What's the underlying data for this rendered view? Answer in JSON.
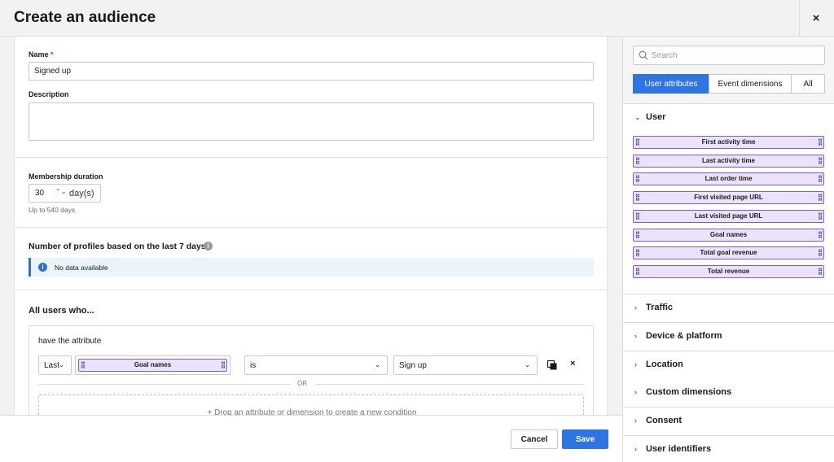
{
  "header": {
    "title": "Create an audience",
    "close_icon": "×"
  },
  "form": {
    "name_label": "Name",
    "required_mark": "*",
    "name_value": "Signed up",
    "description_label": "Description",
    "description_value": "",
    "membership_label": "Membership duration",
    "duration_value": "30",
    "stepper_icon": "⌃⌄",
    "duration_unit": "day(s)",
    "duration_hint": "Up to 540 days",
    "profiles_title": "Number of profiles based on the last 7 days",
    "info_icon_text": "i",
    "no_data_text": "No data available",
    "all_users_title": "All users who...",
    "condition": {
      "title": "have the attribute",
      "qualifier": "Last",
      "attribute": "Goal names",
      "operator": "is",
      "value": "Sign up",
      "chevron": "⌄",
      "delete_icon": "×",
      "or_label": "OR",
      "drop_hint": "+ Drop an attribute or dimension to create a new condition"
    }
  },
  "footer": {
    "cancel_label": "Cancel",
    "save_label": "Save"
  },
  "sidebar": {
    "search_placeholder": "Search",
    "tabs": [
      "User attributes",
      "Event dimensions",
      "All"
    ],
    "active_tab": "User attributes",
    "grip_glyph": "⣿",
    "expanded_chevron": "⌄",
    "collapsed_chevron": "›",
    "user_group": {
      "label": "User",
      "items": [
        "First activity time",
        "Last activity time",
        "Last order time",
        "First visited page URL",
        "Last visited page URL",
        "Goal names",
        "Total goal revenue",
        "Total revenue"
      ]
    },
    "collapsed_groups": [
      "Traffic",
      "Device & platform",
      "Location",
      "Custom dimensions",
      "Consent",
      "User identifiers"
    ]
  },
  "colors": {
    "accent": "#2e75e3",
    "pill_bg": "#ebe2fb",
    "pill_border": "#7c5bd6",
    "notice_bg": "#eaf4fb"
  }
}
